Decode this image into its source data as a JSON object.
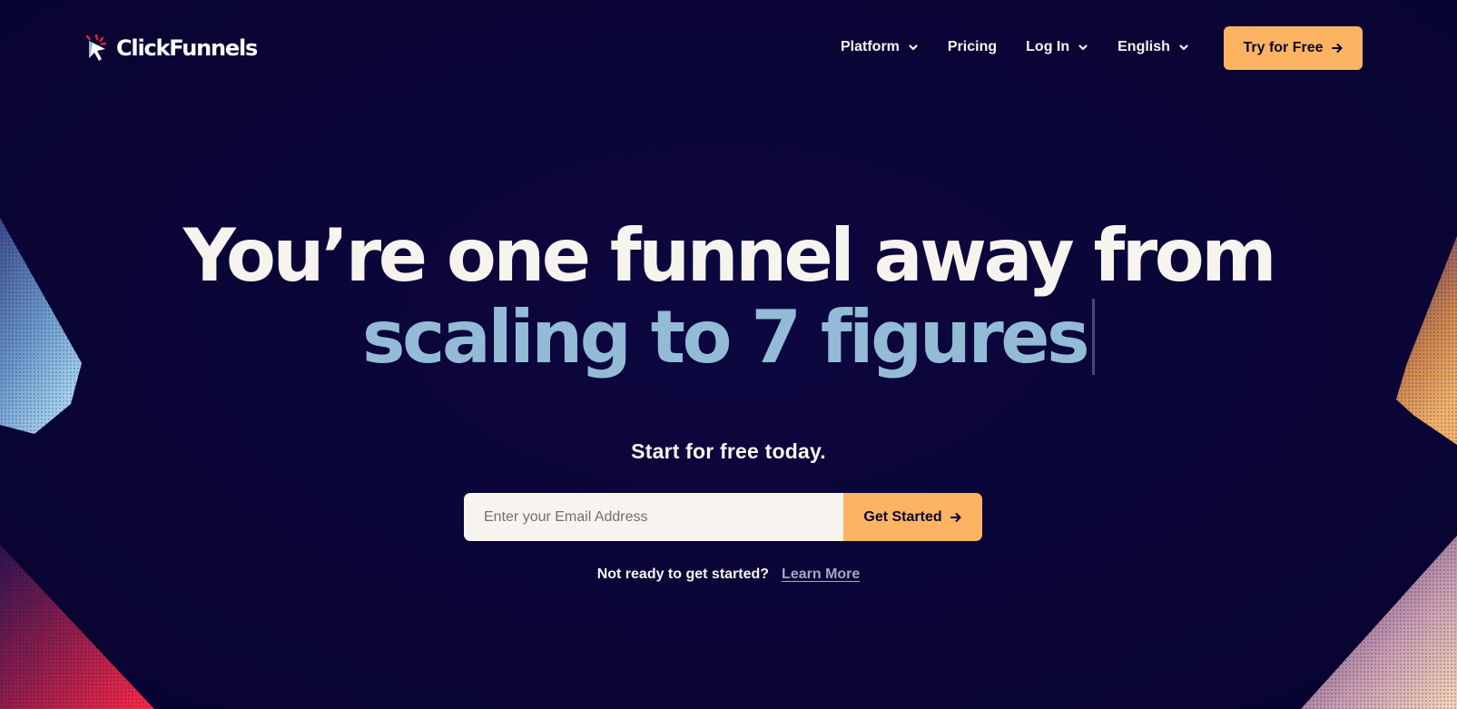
{
  "brand": {
    "name": "ClickFunnels",
    "logo_icon": "cursor-spark-icon",
    "colors": {
      "background": "#0a0535",
      "accent": "#fdb462",
      "highlight": "#93bbd6",
      "text": "#f7f4ef",
      "logo_red": "#e8203c"
    }
  },
  "nav": {
    "items": [
      {
        "label": "Platform",
        "has_dropdown": true
      },
      {
        "label": "Pricing",
        "has_dropdown": false
      },
      {
        "label": "Log In",
        "has_dropdown": true
      },
      {
        "label": "English",
        "has_dropdown": true
      }
    ],
    "cta_label": "Try for Free",
    "cta_icon": "arrow-right-icon"
  },
  "hero": {
    "line1": "You’re one funnel away from",
    "line2": "scaling to 7 figures",
    "subhead": "Start for free today."
  },
  "signup": {
    "email_placeholder": "Enter your Email Address",
    "email_value": "",
    "button_label": "Get Started",
    "button_icon": "arrow-right-icon"
  },
  "footer_prompt": {
    "text": "Not ready to get started?",
    "link_label": "Learn More"
  }
}
